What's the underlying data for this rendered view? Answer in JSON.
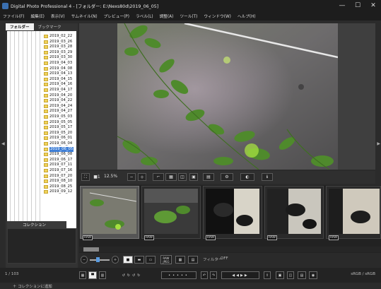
{
  "window": {
    "title": "Digital Photo Professional 4 - [フォルダー: E:\\Nexs80d\\2019_06_05]",
    "minimize": "—",
    "maximize": "☐",
    "close": "✕"
  },
  "menu": [
    "ファイル(F)",
    "編集(E)",
    "表示(V)",
    "サムネイル(N)",
    "プレビュー(P)",
    "ラベル(L)",
    "調整(A)",
    "ツール(T)",
    "ウィンドウ(W)",
    "ヘルプ(H)"
  ],
  "left_panel": {
    "tabs": [
      "フォルダー",
      "ブックマーク"
    ],
    "folders": [
      "2019_02_22",
      "2019_03_26",
      "2019_03_28",
      "2019_03_29",
      "2019_03_30",
      "2019_04_03",
      "2019_04_08",
      "2019_04_13",
      "2019_04_15",
      "2019_04_16",
      "2019_04_17",
      "2019_04_20",
      "2019_04_22",
      "2019_04_24",
      "2019_04_27",
      "2019_05_03",
      "2019_05_05",
      "2019_05_17",
      "2019_05_20",
      "2019_06_01",
      "2019_06_04",
      "2019_06_05",
      "2019_06_08",
      "2019_06_17",
      "2019_07_11",
      "2019_07_16",
      "2019_07_20",
      "2019_08_10",
      "2019_08_25",
      "2019_09_12"
    ],
    "selected_folder": "2019_06_05",
    "collection_tab": "コレクション",
    "add_collection": "＋ コレクションに追加"
  },
  "viewer_toolbar": {
    "zoom": "12.5%",
    "fit_label": "⛶",
    "one_to_one": "■1"
  },
  "thumbnails": [
    {
      "badge": "RAW",
      "selected": true
    },
    {
      "badge": "RAW",
      "selected": false
    },
    {
      "badge": "RAW",
      "selected": false
    },
    {
      "badge": "RAW",
      "selected": false
    },
    {
      "badge": "RAW",
      "selected": false
    }
  ],
  "bottom_toolbar": {
    "raw_jpeg": "RAW\nJPEG",
    "filter_label": "フィルター",
    "filter_value": "OFF"
  },
  "status": {
    "count": "1 / 103",
    "color_space": "sRGB / sRGB"
  },
  "colors": {
    "accent_selection": "#3f7fd6",
    "folder": "#f0d35a"
  }
}
